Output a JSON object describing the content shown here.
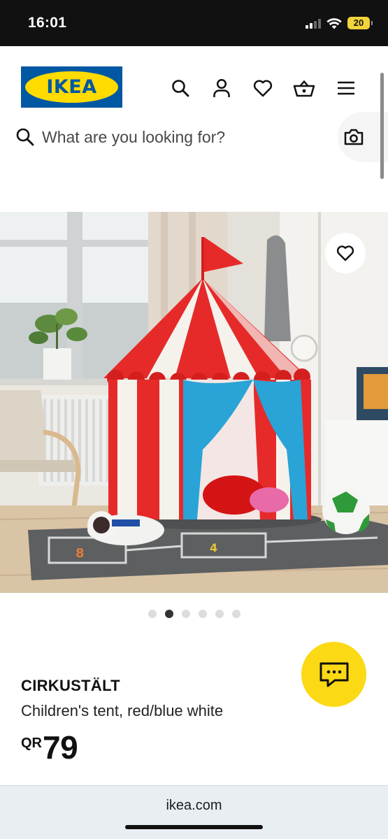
{
  "status_bar": {
    "time": "16:01",
    "battery": "20",
    "icons": [
      "signal-icon",
      "wifi-icon",
      "battery-icon"
    ]
  },
  "header": {
    "logo_text": "IKEA",
    "brand_colors": {
      "blue": "#0058a3",
      "yellow": "#ffdb00"
    },
    "icons": [
      "search-icon",
      "account-icon",
      "favorites-icon",
      "basket-icon",
      "menu-icon"
    ]
  },
  "search": {
    "placeholder": "What are you looking for?",
    "value": "",
    "camera_icon": "camera-icon"
  },
  "gallery": {
    "image_subject": "red and white striped circus tent with blue curtains in a children's room",
    "dot_count": 6,
    "active_index": 1
  },
  "product": {
    "name": "CIRKUSTÄLT",
    "description": "Children's tent, red/blue white",
    "currency": "QR",
    "price": "79"
  },
  "chat": {
    "icon": "chat-icon",
    "color": "#fbd914"
  },
  "browser": {
    "url": "ikea.com"
  }
}
